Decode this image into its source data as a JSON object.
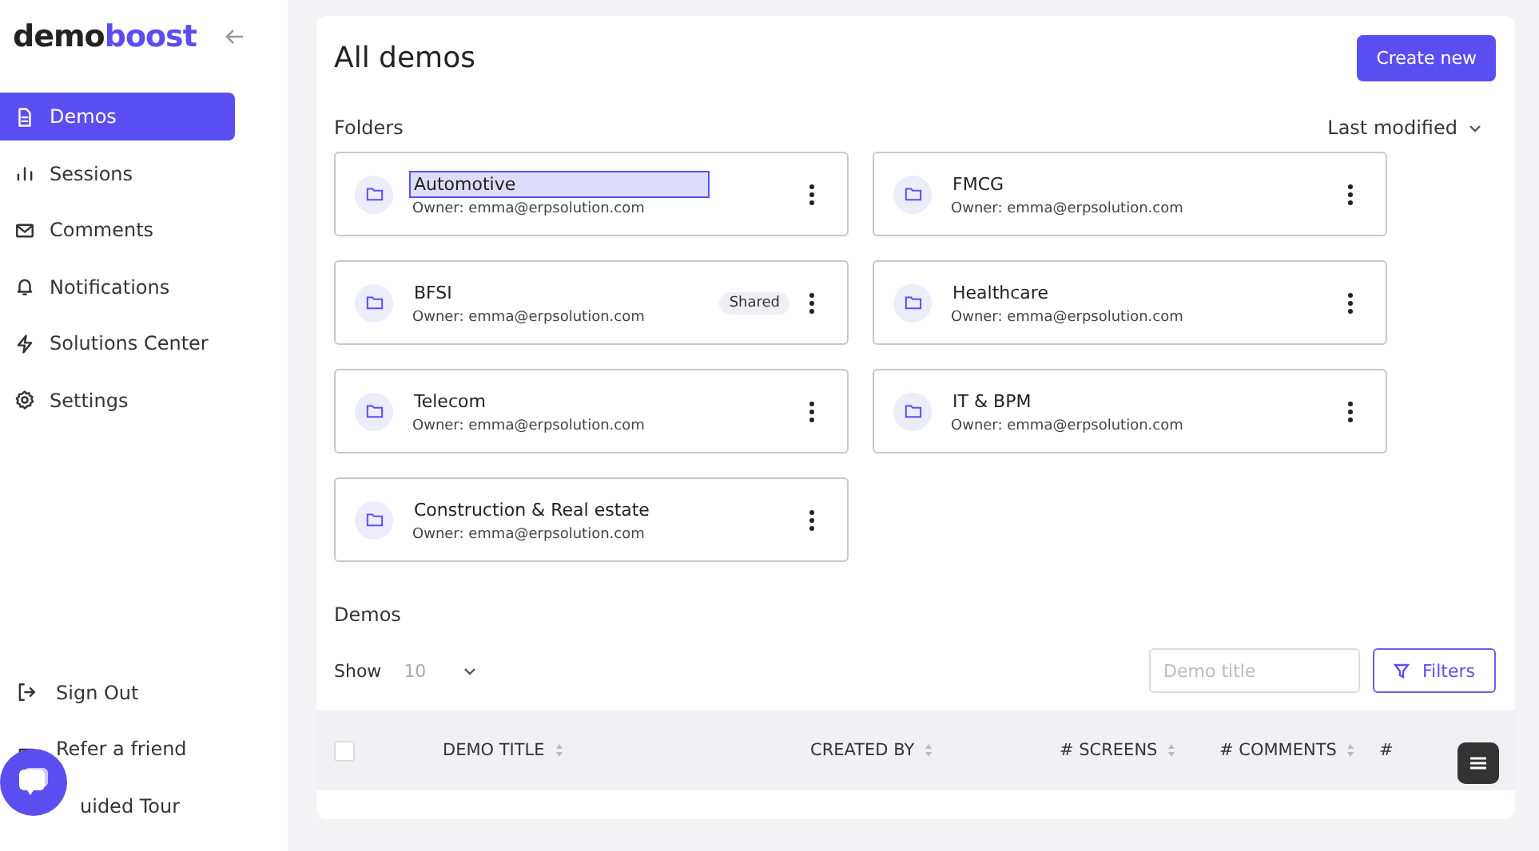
{
  "sidebar": {
    "logo": {
      "part_1": "demo",
      "part_2": "boost"
    },
    "items": [
      {
        "label": "Demos",
        "selected": true
      },
      {
        "label": "Sessions",
        "selected": false
      },
      {
        "label": "Comments",
        "selected": false
      },
      {
        "label": "Notifications",
        "selected": false
      },
      {
        "label": "Solutions Center",
        "selected": false
      },
      {
        "label": "Settings",
        "selected": false
      }
    ],
    "bottom_items": [
      {
        "label": "Sign Out"
      },
      {
        "label": "Refer a friend"
      },
      {
        "label": "uided Tour"
      }
    ]
  },
  "header": {
    "title": "All demos",
    "create_button": "Create new"
  },
  "folders": {
    "heading": "Folders",
    "sort": "Last modified",
    "items": [
      {
        "name": "Automotive",
        "owner": "Owner: emma@erpsolution.com",
        "selected": true
      },
      {
        "name": "FMCG",
        "owner": "Owner: emma@erpsolution.com",
        "selected": false
      },
      {
        "name": "BFSI",
        "owner": "Owner: emma@erpsolution.com",
        "badge": "Shared",
        "selected": false
      },
      {
        "name": "Healthcare",
        "owner": "Owner: emma@erpsolution.com",
        "selected": false
      },
      {
        "name": "Telecom",
        "owner": "Owner: emma@erpsolution.com",
        "selected": false
      },
      {
        "name": "IT & BPM",
        "owner": "Owner: emma@erpsolution.com",
        "selected": false
      },
      {
        "name": "Construction & Real estate",
        "owner": "Owner: emma@erpsolution.com",
        "selected": false
      }
    ]
  },
  "demos": {
    "heading": "Demos",
    "show_label": "Show",
    "page_size": "10",
    "search": {
      "placeholder": "Demo title"
    },
    "filters_button": "Filters",
    "table": {
      "select_all_checked": false,
      "columns": [
        "DEMO TITLE",
        "CREATED BY",
        "# SCREENS",
        "# COMMENTS",
        "#"
      ]
    }
  }
}
